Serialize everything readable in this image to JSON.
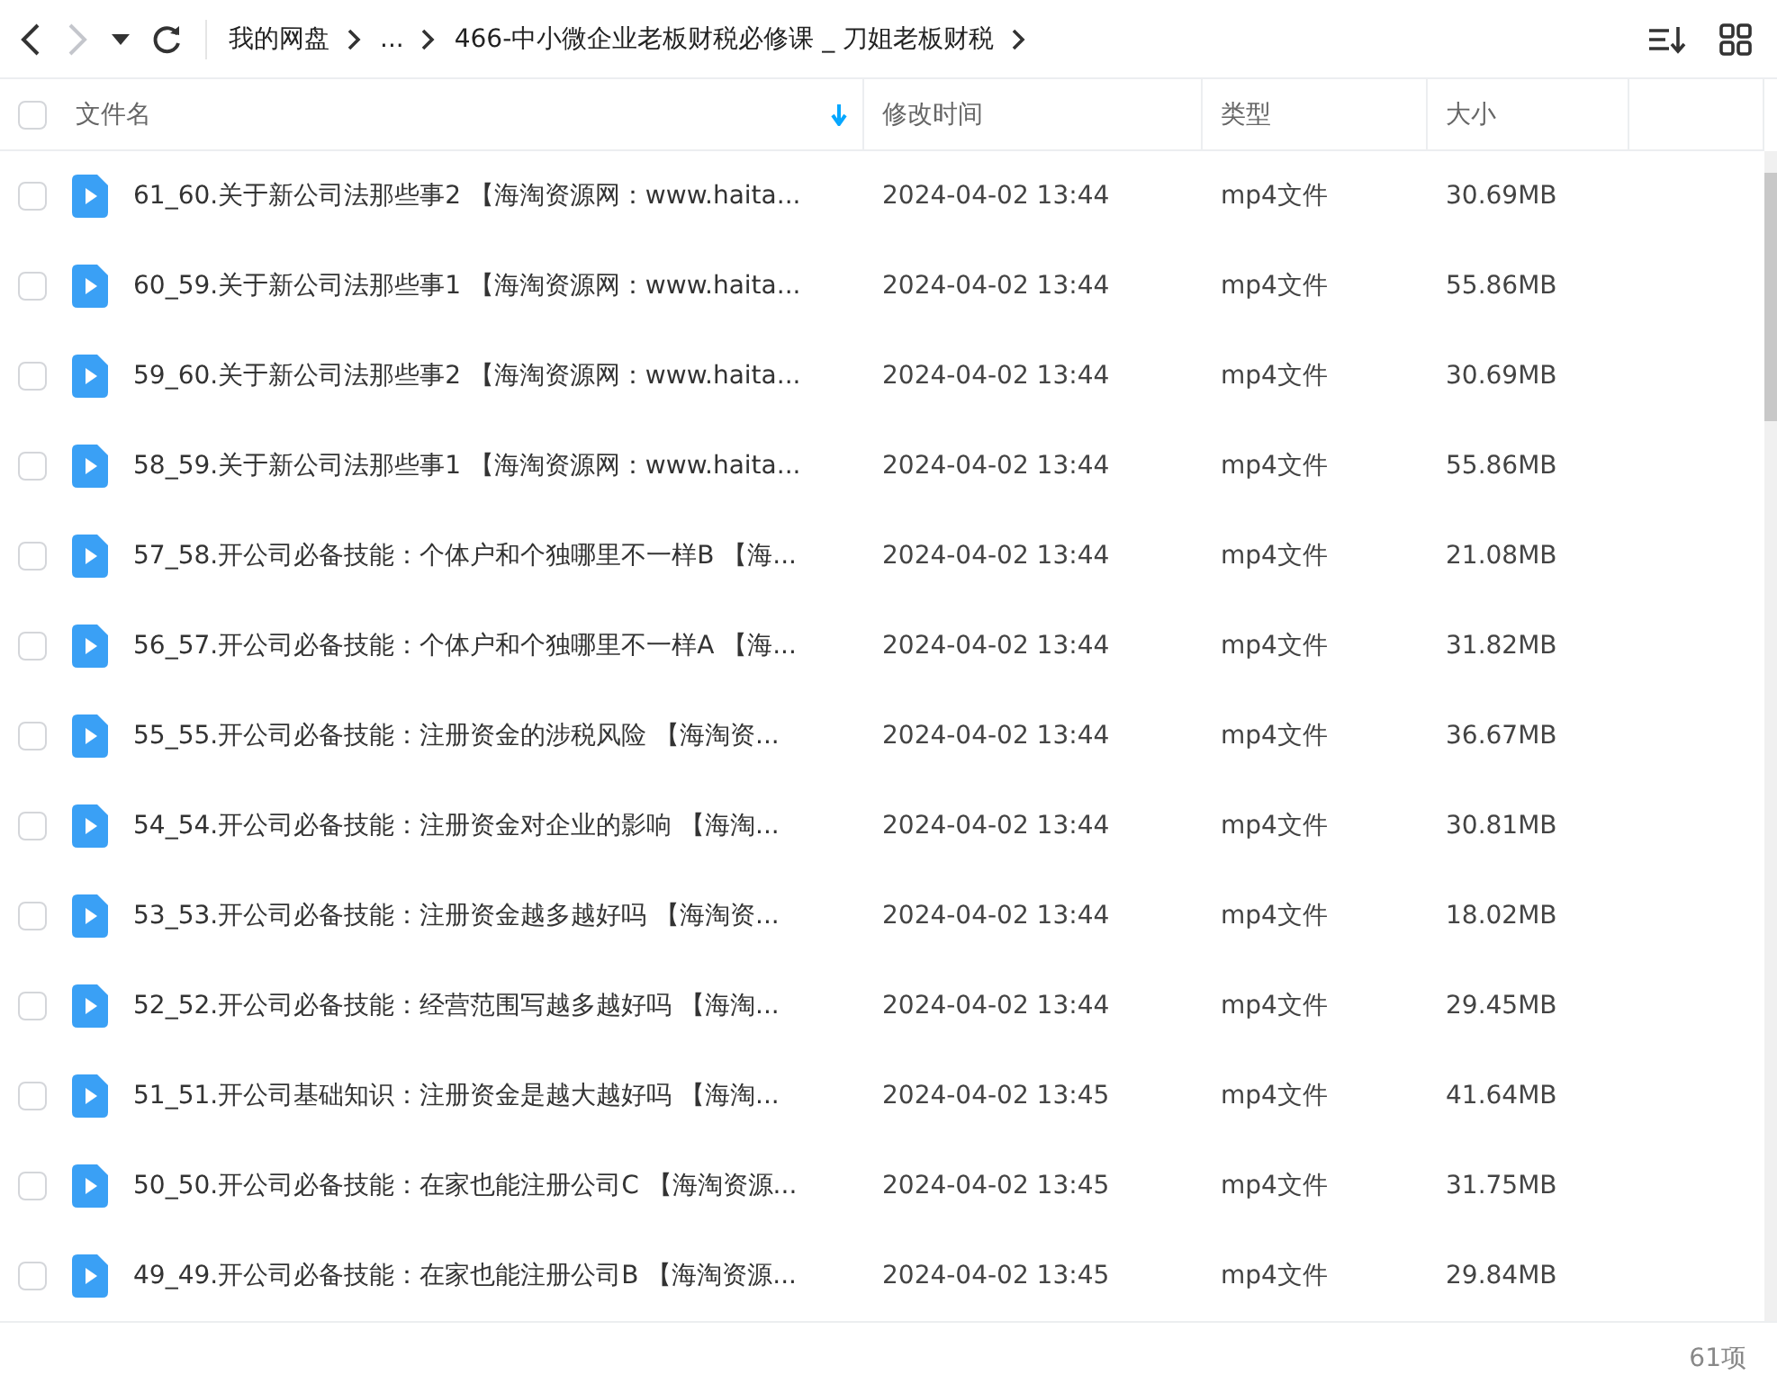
{
  "toolbar": {
    "nav": [
      {
        "kind": "back",
        "disabled": false
      },
      {
        "kind": "forward",
        "disabled": true
      },
      {
        "kind": "history",
        "disabled": false
      },
      {
        "kind": "refresh",
        "disabled": false
      }
    ],
    "breadcrumb": [
      "我的网盘",
      "...",
      "466-中小微企业老板财税必修课 _ 刀姐老板财税"
    ]
  },
  "table": {
    "select_all": {
      "checked": false
    },
    "columns": [
      {
        "label": "文件名",
        "sorted": true
      },
      {
        "label": "修改时间",
        "sorted": false
      },
      {
        "label": "类型",
        "sorted": false
      },
      {
        "label": "大小",
        "sorted": false
      }
    ],
    "rows": [
      {
        "checked": false,
        "name": "61_60.关于新公司法那些事2 【海淘资源网：www.haita...",
        "modified": "2024-04-02 13:44",
        "type": "mp4文件",
        "size": "30.69MB"
      },
      {
        "checked": false,
        "name": "60_59.关于新公司法那些事1 【海淘资源网：www.haita...",
        "modified": "2024-04-02 13:44",
        "type": "mp4文件",
        "size": "55.86MB"
      },
      {
        "checked": false,
        "name": "59_60.关于新公司法那些事2 【海淘资源网：www.haita...",
        "modified": "2024-04-02 13:44",
        "type": "mp4文件",
        "size": "30.69MB"
      },
      {
        "checked": false,
        "name": "58_59.关于新公司法那些事1 【海淘资源网：www.haita...",
        "modified": "2024-04-02 13:44",
        "type": "mp4文件",
        "size": "55.86MB"
      },
      {
        "checked": false,
        "name": "57_58.开公司必备技能：个体户和个独哪里不一样B 【海...",
        "modified": "2024-04-02 13:44",
        "type": "mp4文件",
        "size": "21.08MB"
      },
      {
        "checked": false,
        "name": "56_57.开公司必备技能：个体户和个独哪里不一样A 【海...",
        "modified": "2024-04-02 13:44",
        "type": "mp4文件",
        "size": "31.82MB"
      },
      {
        "checked": false,
        "name": "55_55.开公司必备技能：注册资金的涉税风险 【海淘资...",
        "modified": "2024-04-02 13:44",
        "type": "mp4文件",
        "size": "36.67MB"
      },
      {
        "checked": false,
        "name": "54_54.开公司必备技能：注册资金对企业的影响 【海淘...",
        "modified": "2024-04-02 13:44",
        "type": "mp4文件",
        "size": "30.81MB"
      },
      {
        "checked": false,
        "name": "53_53.开公司必备技能：注册资金越多越好吗 【海淘资...",
        "modified": "2024-04-02 13:44",
        "type": "mp4文件",
        "size": "18.02MB"
      },
      {
        "checked": false,
        "name": "52_52.开公司必备技能：经营范围写越多越好吗 【海淘...",
        "modified": "2024-04-02 13:44",
        "type": "mp4文件",
        "size": "29.45MB"
      },
      {
        "checked": false,
        "name": "51_51.开公司基础知识：注册资金是越大越好吗 【海淘...",
        "modified": "2024-04-02 13:45",
        "type": "mp4文件",
        "size": "41.64MB"
      },
      {
        "checked": false,
        "name": "50_50.开公司必备技能：在家也能注册公司C 【海淘资源...",
        "modified": "2024-04-02 13:45",
        "type": "mp4文件",
        "size": "31.75MB"
      },
      {
        "checked": false,
        "name": "49_49.开公司必备技能：在家也能注册公司B 【海淘资源...",
        "modified": "2024-04-02 13:45",
        "type": "mp4文件",
        "size": "29.84MB"
      }
    ]
  },
  "status_bar": {
    "count": "61项"
  }
}
